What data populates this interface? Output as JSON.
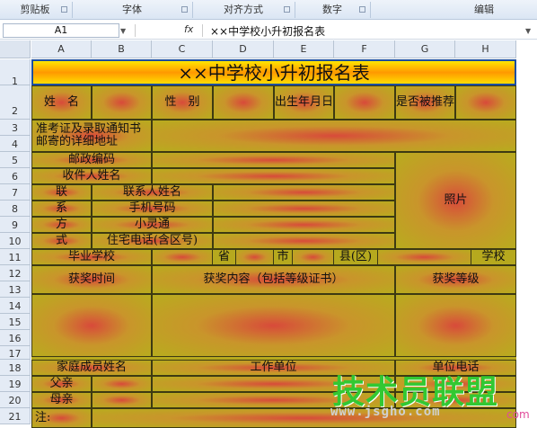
{
  "ribbon": {
    "groups": [
      "剪贴板",
      "字体",
      "对齐方式",
      "数字",
      "编辑"
    ]
  },
  "formula_bar": {
    "name_box": "A1",
    "fx_label": "fx",
    "content": "××中学校小升初报名表"
  },
  "columns": [
    "A",
    "B",
    "C",
    "D",
    "E",
    "F",
    "G",
    "H"
  ],
  "rows": [
    "1",
    "2",
    "3",
    "4",
    "5",
    "6",
    "7",
    "8",
    "9",
    "10",
    "11",
    "12",
    "13",
    "14",
    "15",
    "16",
    "17",
    "18",
    "19",
    "20",
    "21"
  ],
  "sheet": {
    "title": "××中学校小升初报名表",
    "name_label": "姓　名",
    "gender_label": "性　别",
    "birth_label": "出生年月日",
    "recommend_label": "是否被推荐",
    "address_label": "准考证及录取通知书邮寄的详细地址",
    "postcode_label": "邮政编码",
    "recipient_label": "收件人姓名",
    "contact_chars": [
      "联",
      "系",
      "方",
      "式"
    ],
    "contact_name": "联系人姓名",
    "phone": "手机号码",
    "xiaolingtong": "小灵通",
    "home_phone": "住宅电话(含区号)",
    "photo": "照片",
    "grad_school": "毕业学校",
    "province": "省",
    "city": "市",
    "county": "县(区)",
    "school": "学校",
    "award_time": "获奖时间",
    "award_content": "获奖内容（包括等级证书）",
    "award_level": "获奖等级",
    "family_name": "家庭成员姓名",
    "work_unit": "工作单位",
    "unit_phone": "单位电话",
    "father": "父亲",
    "mother": "母亲",
    "note": "注:"
  },
  "watermark": {
    "main": "技术员联盟",
    "url": "www.jsgho.com",
    "suffix": "com"
  },
  "colors": {
    "title_yellow": "#ffe600",
    "cell_red": "#d84a3a",
    "cell_olive": "#b8ac1e",
    "watermark_green": "#32c832"
  }
}
